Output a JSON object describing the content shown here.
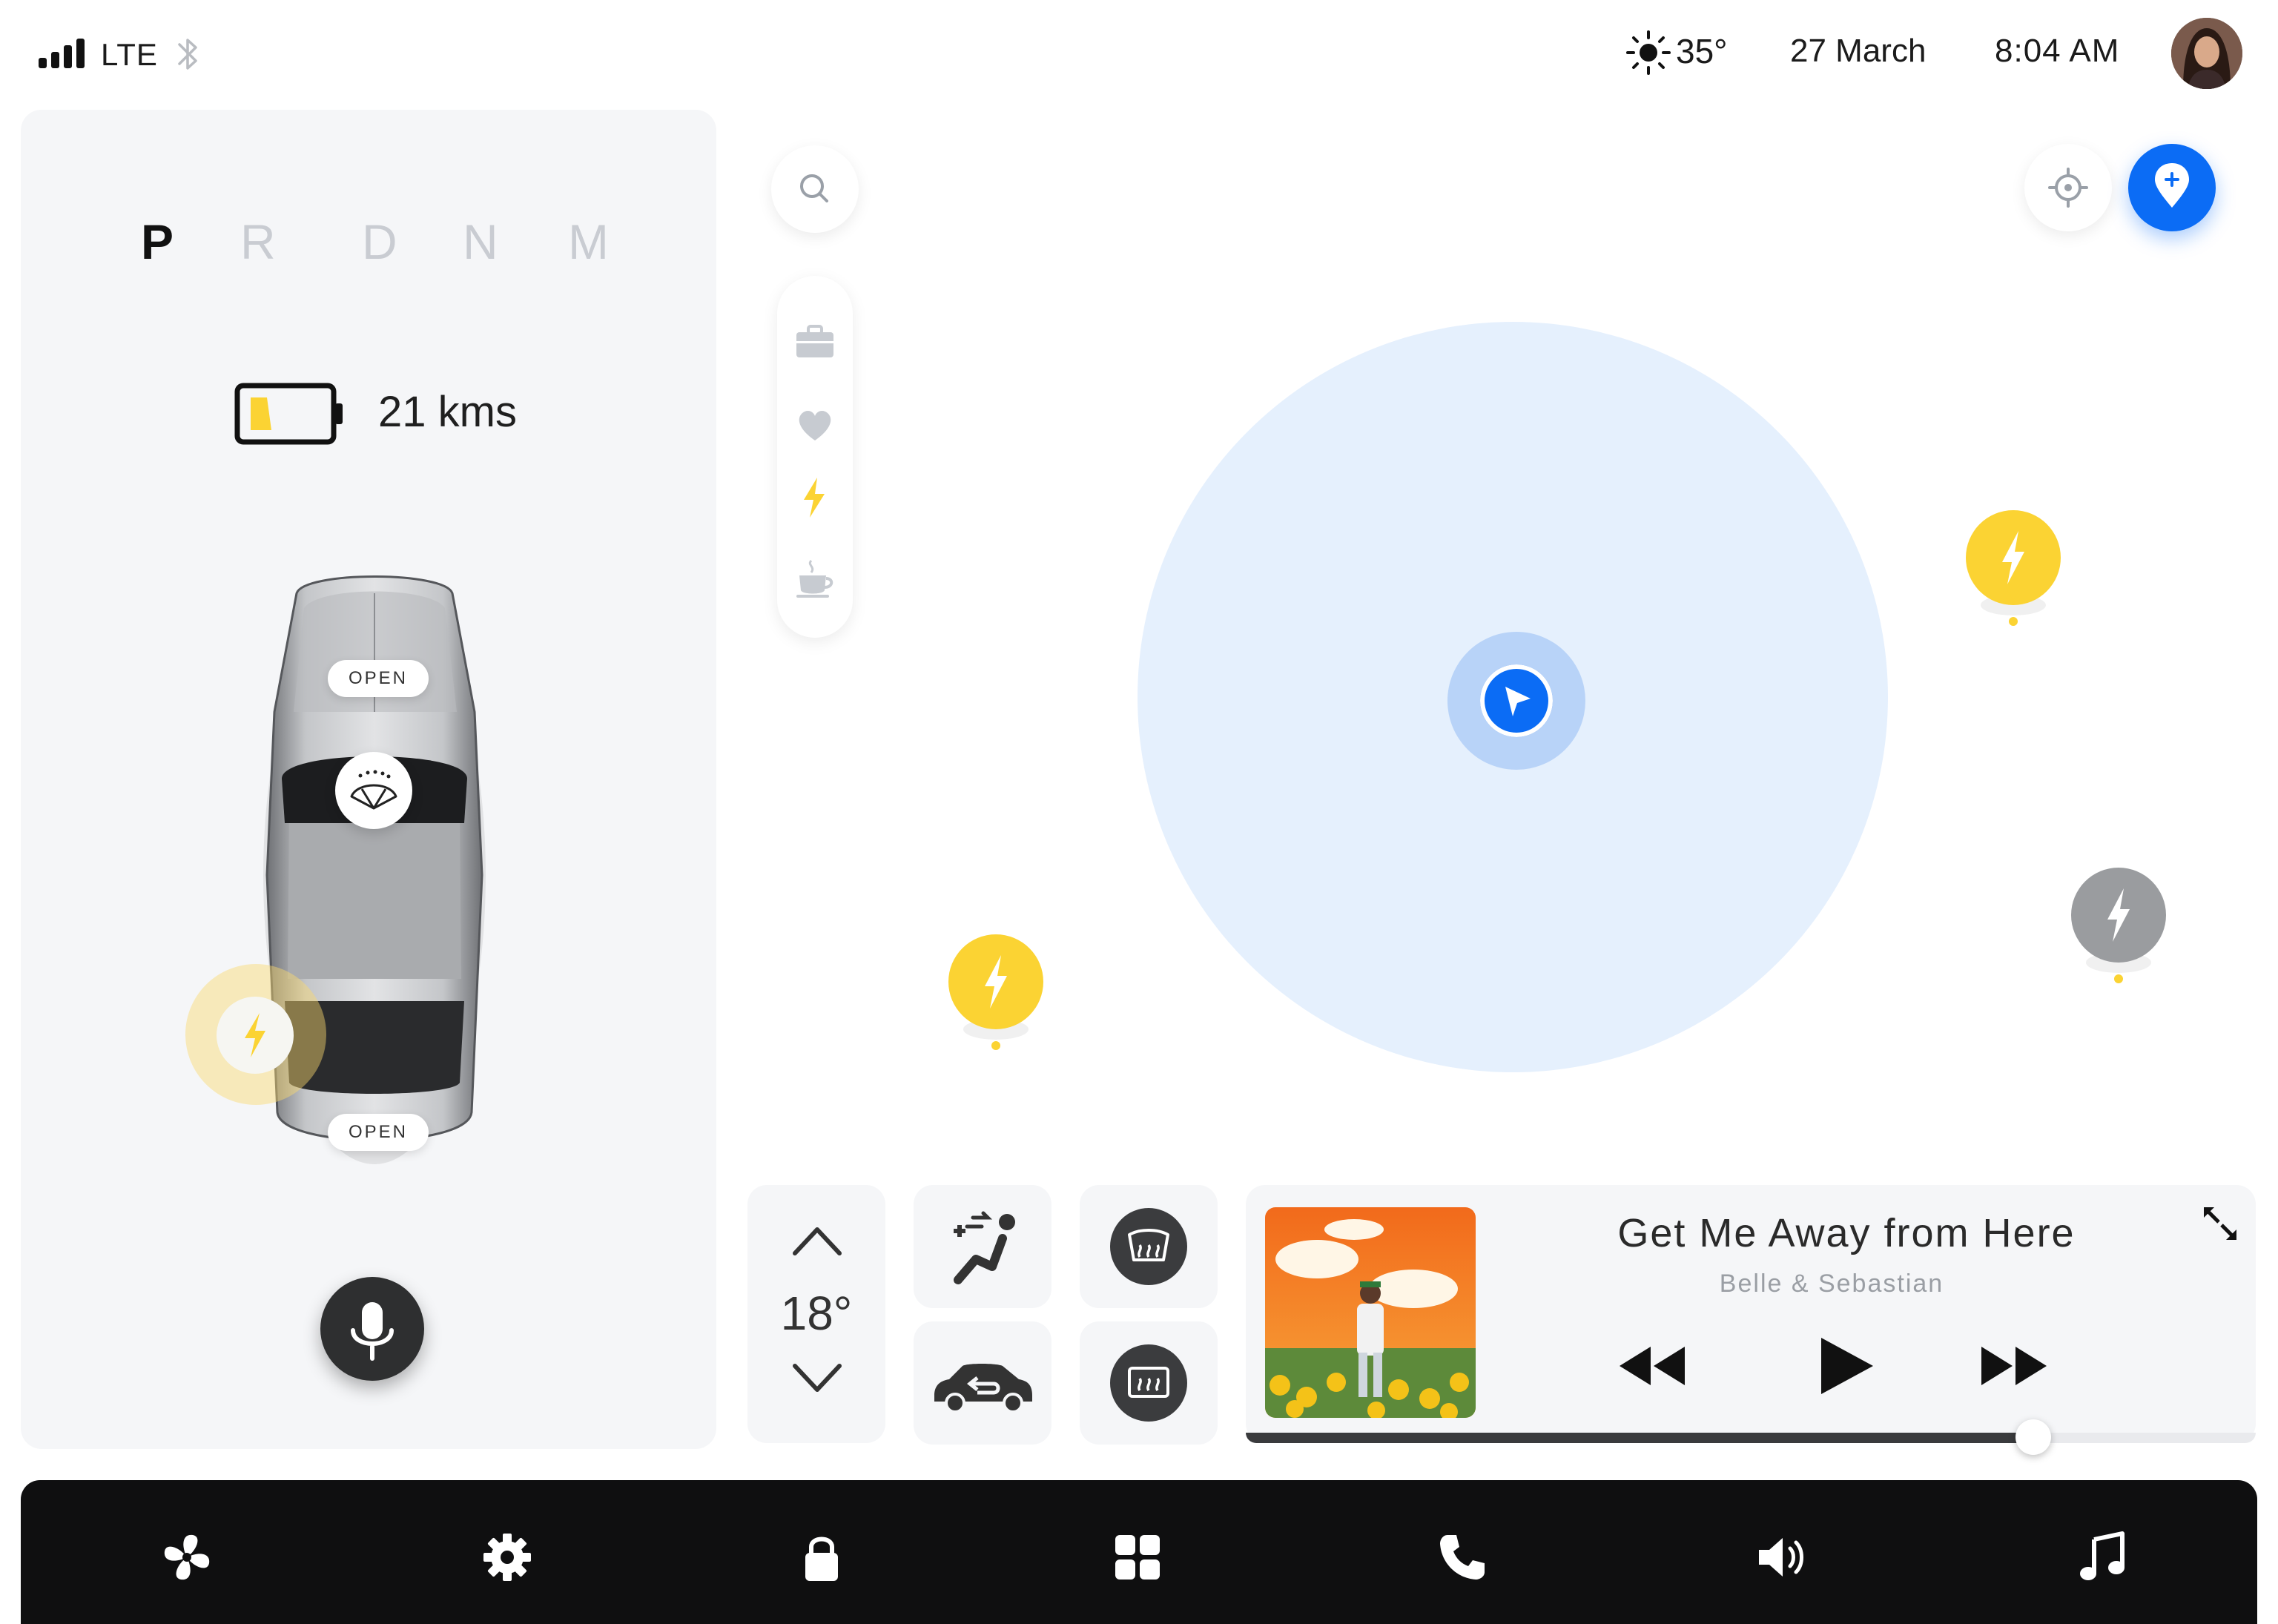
{
  "status": {
    "network": "LTE",
    "temperature": "35°",
    "date": "27 March",
    "time": "8:04 AM"
  },
  "vehicle": {
    "gears": [
      "P",
      "R",
      "D",
      "N",
      "M"
    ],
    "active_gear": "P",
    "battery_level": 0.15,
    "range": "21 kms",
    "front_trunk_label": "OPEN",
    "rear_trunk_label": "OPEN"
  },
  "map": {
    "poi_categories": [
      "briefcase-icon",
      "heart-icon",
      "bolt-icon",
      "coffee-icon"
    ],
    "active_poi_category": "bolt-icon",
    "charging_stations": [
      "available",
      "available",
      "unavailable"
    ]
  },
  "climate": {
    "temperature": "18°"
  },
  "music": {
    "track": "Get Me Away from Here",
    "artist": "Belle & Sebastian",
    "progress": 0.78
  },
  "dock": {
    "items": [
      "fan-icon",
      "settings-icon",
      "lock-icon",
      "apps-icon",
      "phone-icon",
      "volume-icon",
      "music-icon"
    ]
  },
  "colors": {
    "accent_blue": "#0b6cf5",
    "charge_yellow": "#fbd333",
    "dark": "#2e2f30",
    "panel_bg": "#f5f6f8"
  }
}
